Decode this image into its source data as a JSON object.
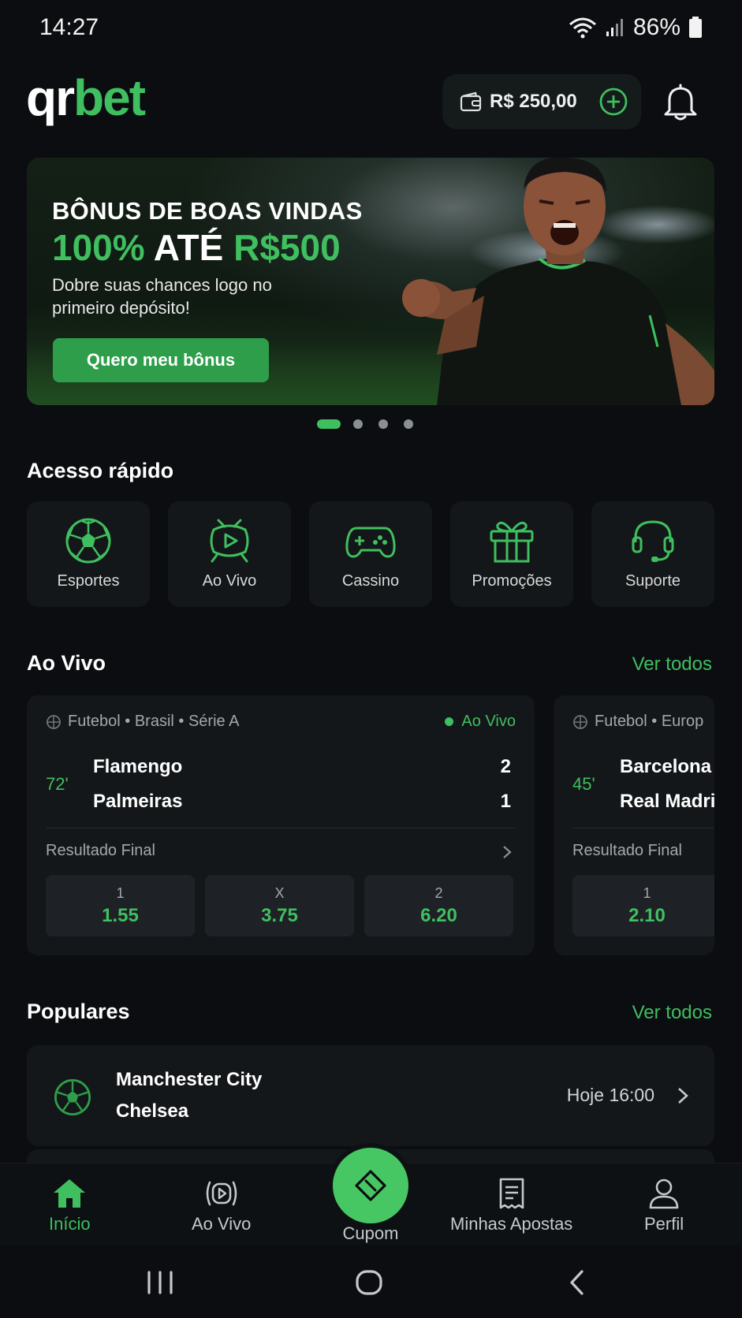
{
  "status_bar": {
    "time": "14:27",
    "battery": "86%"
  },
  "header": {
    "logo_qr": "qr",
    "logo_bet": "bet",
    "balance": "R$ 250,00"
  },
  "banner": {
    "title": "BÔNUS DE BOAS VINDAS",
    "headline_part1": "100%",
    "headline_part2": " ATÉ ",
    "headline_part3": "R$500",
    "subtitle": "Dobre suas chances logo no primeiro depósito!",
    "cta": "Quero meu bônus",
    "slides_total": 4,
    "active_slide": 1
  },
  "quick_access": {
    "title": "Acesso rápido",
    "items": [
      {
        "label": "Esportes",
        "icon": "soccer-ball-icon"
      },
      {
        "label": "Ao Vivo",
        "icon": "live-tv-icon"
      },
      {
        "label": "Cassino",
        "icon": "gamepad-icon"
      },
      {
        "label": "Promoções",
        "icon": "gift-icon"
      },
      {
        "label": "Suporte",
        "icon": "headset-icon"
      }
    ]
  },
  "live": {
    "title": "Ao Vivo",
    "see_all": "Ver todos",
    "matches": [
      {
        "meta": "Futebol • Brasil • Série A",
        "live_label": "Ao Vivo",
        "minute": "72'",
        "home": "Flamengo",
        "away": "Palmeiras",
        "home_score": "2",
        "away_score": "1",
        "market": "Resultado Final",
        "odds": [
          {
            "label": "1",
            "value": "1.55"
          },
          {
            "label": "X",
            "value": "3.75"
          },
          {
            "label": "2",
            "value": "6.20"
          }
        ]
      },
      {
        "meta": "Futebol • Europ",
        "minute": "45'",
        "home": "Barcelona",
        "away": "Real Madri",
        "market": "Resultado Final",
        "odds": [
          {
            "label": "1",
            "value": "2.10"
          }
        ]
      }
    ]
  },
  "popular": {
    "title": "Populares",
    "see_all": "Ver todos",
    "items": [
      {
        "home": "Manchester City",
        "away": "Chelsea",
        "time": "Hoje 16:00"
      }
    ]
  },
  "bottom_nav": {
    "items": [
      {
        "label": "Início",
        "active": true
      },
      {
        "label": "Ao Vivo"
      },
      {
        "label": "Cupom"
      },
      {
        "label": "Minhas Apostas"
      },
      {
        "label": "Perfil"
      }
    ]
  },
  "colors": {
    "accent": "#3fbf5f",
    "background": "#0b0d10",
    "card": "#141719"
  }
}
